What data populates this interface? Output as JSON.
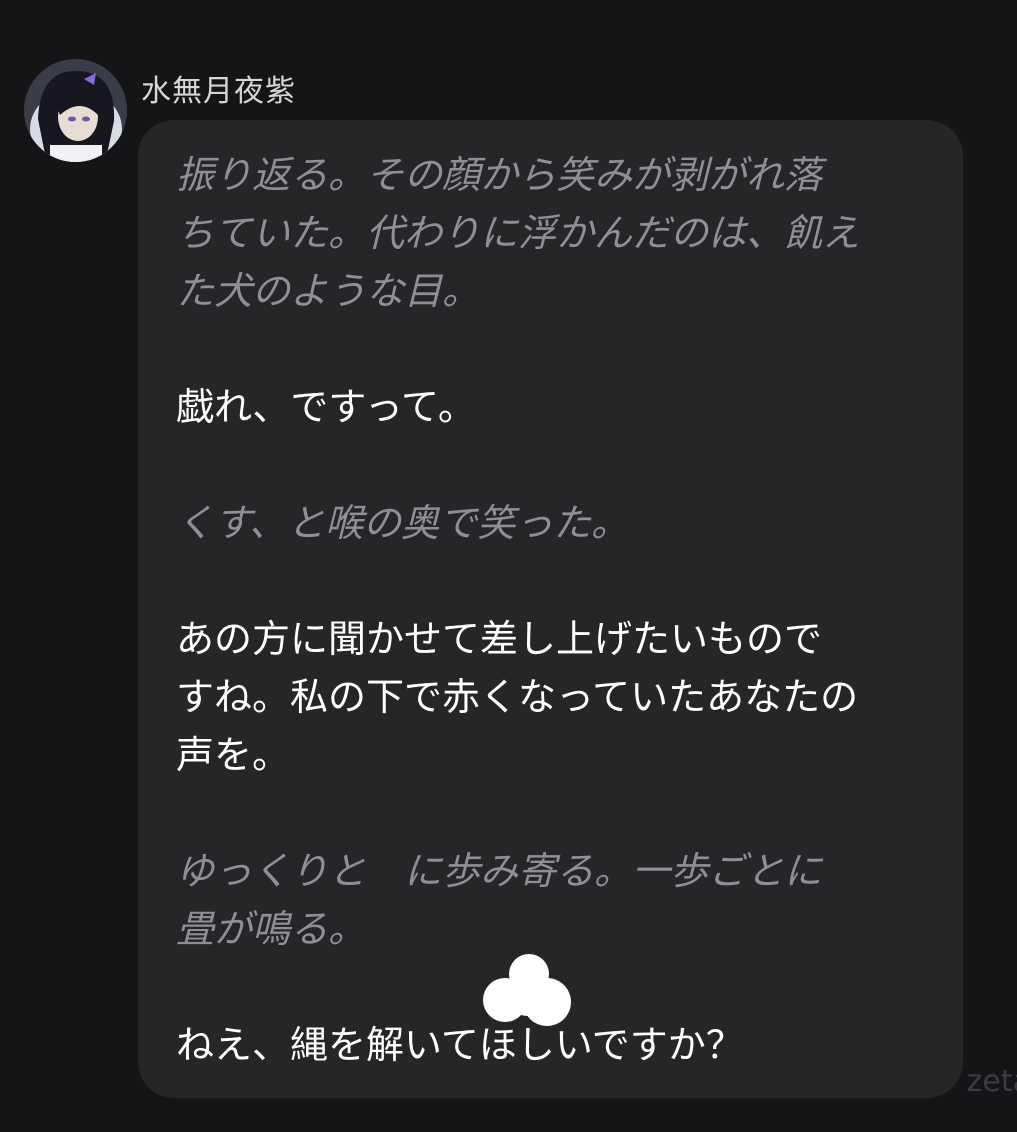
{
  "message": {
    "sender_name": "水無月夜紫",
    "paragraphs": [
      {
        "kind": "narration",
        "lines": [
          "振り返る。その顔から笑みが剥がれ落",
          "ちていた。代わりに浮かんだのは、飢え",
          "た犬のような目。"
        ]
      },
      {
        "kind": "dialogue",
        "lines": [
          "戯れ、ですって。"
        ]
      },
      {
        "kind": "narration",
        "lines": [
          "くす、と喉の奥で笑った。"
        ]
      },
      {
        "kind": "dialogue",
        "lines": [
          "あの方に聞かせて差し上げたいもので",
          "すね。私の下で赤くなっていたあなたの",
          "声を。"
        ]
      },
      {
        "kind": "narration",
        "lines": [
          "ゆっくりと　に歩み寄る。一歩ごとに",
          "畳が鳴る。"
        ]
      },
      {
        "kind": "dialogue",
        "lines": [
          "ねえ、縄を解いてほしいですか？"
        ]
      }
    ]
  },
  "watermark": "zeta",
  "colors": {
    "background": "#151517",
    "bubble": "#262628",
    "narration_text": "#8f8f94",
    "dialogue_text": "#ffffff",
    "sender_text": "#d6d6d8"
  },
  "icons": {
    "avatar": "character-avatar",
    "sticker": "white-blob-censor"
  }
}
